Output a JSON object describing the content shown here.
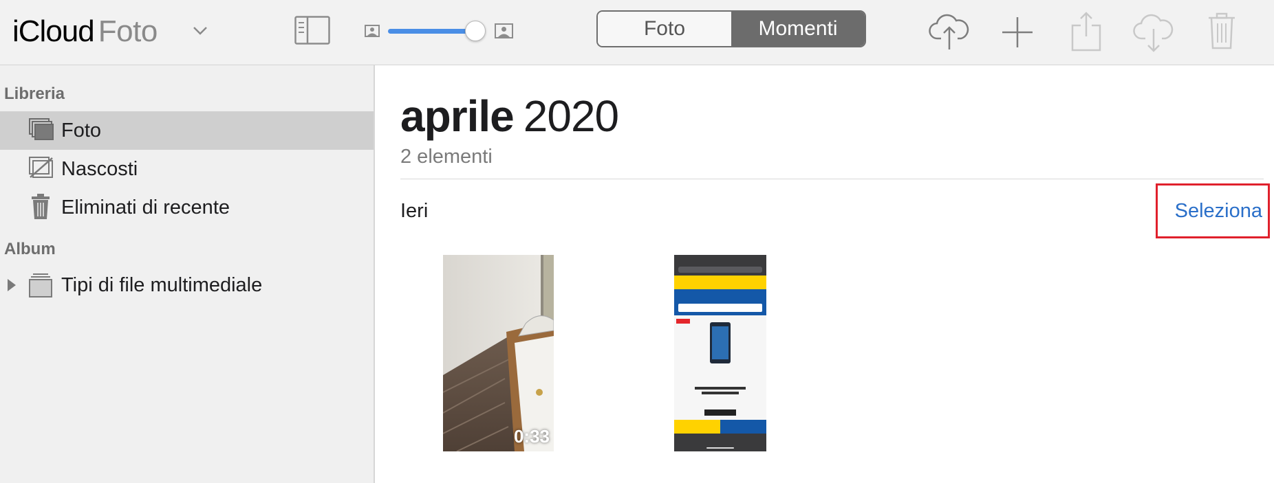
{
  "toolbar": {
    "app_name": "iCloud",
    "section_name": "Foto",
    "view_toggle": {
      "options": [
        "Foto",
        "Momenti"
      ],
      "selected": "Momenti"
    },
    "zoom": {
      "level": 0.95
    },
    "icons": [
      "sidebar-toggle-icon",
      "small-photo-icon",
      "large-photo-icon",
      "cloud-upload-icon",
      "add-icon",
      "share-icon",
      "cloud-download-icon",
      "trash-icon"
    ],
    "accent": "#4a8ee6",
    "disabled_color": "#c8c8c8"
  },
  "sidebar": {
    "library_heading": "Libreria",
    "items": [
      {
        "label": "Foto",
        "icon": "photos-stack-icon",
        "selected": true
      },
      {
        "label": "Nascosti",
        "icon": "hidden-photos-icon",
        "selected": false
      },
      {
        "label": "Eliminati di recente",
        "icon": "trash-icon",
        "selected": false
      }
    ],
    "album_heading": "Album",
    "albums": [
      {
        "label": "Tipi di file multimediale",
        "icon": "album-stack-icon",
        "expanded": false
      }
    ]
  },
  "main": {
    "month": "aprile",
    "year": "2020",
    "item_count": "2 elementi",
    "section_label": "Ieri",
    "select_button": "Seleziona",
    "select_color": "#2a6fc9",
    "highlight_color": "#e0202c",
    "items": [
      {
        "type": "video",
        "duration": "0:33"
      },
      {
        "type": "screenshot"
      }
    ]
  }
}
